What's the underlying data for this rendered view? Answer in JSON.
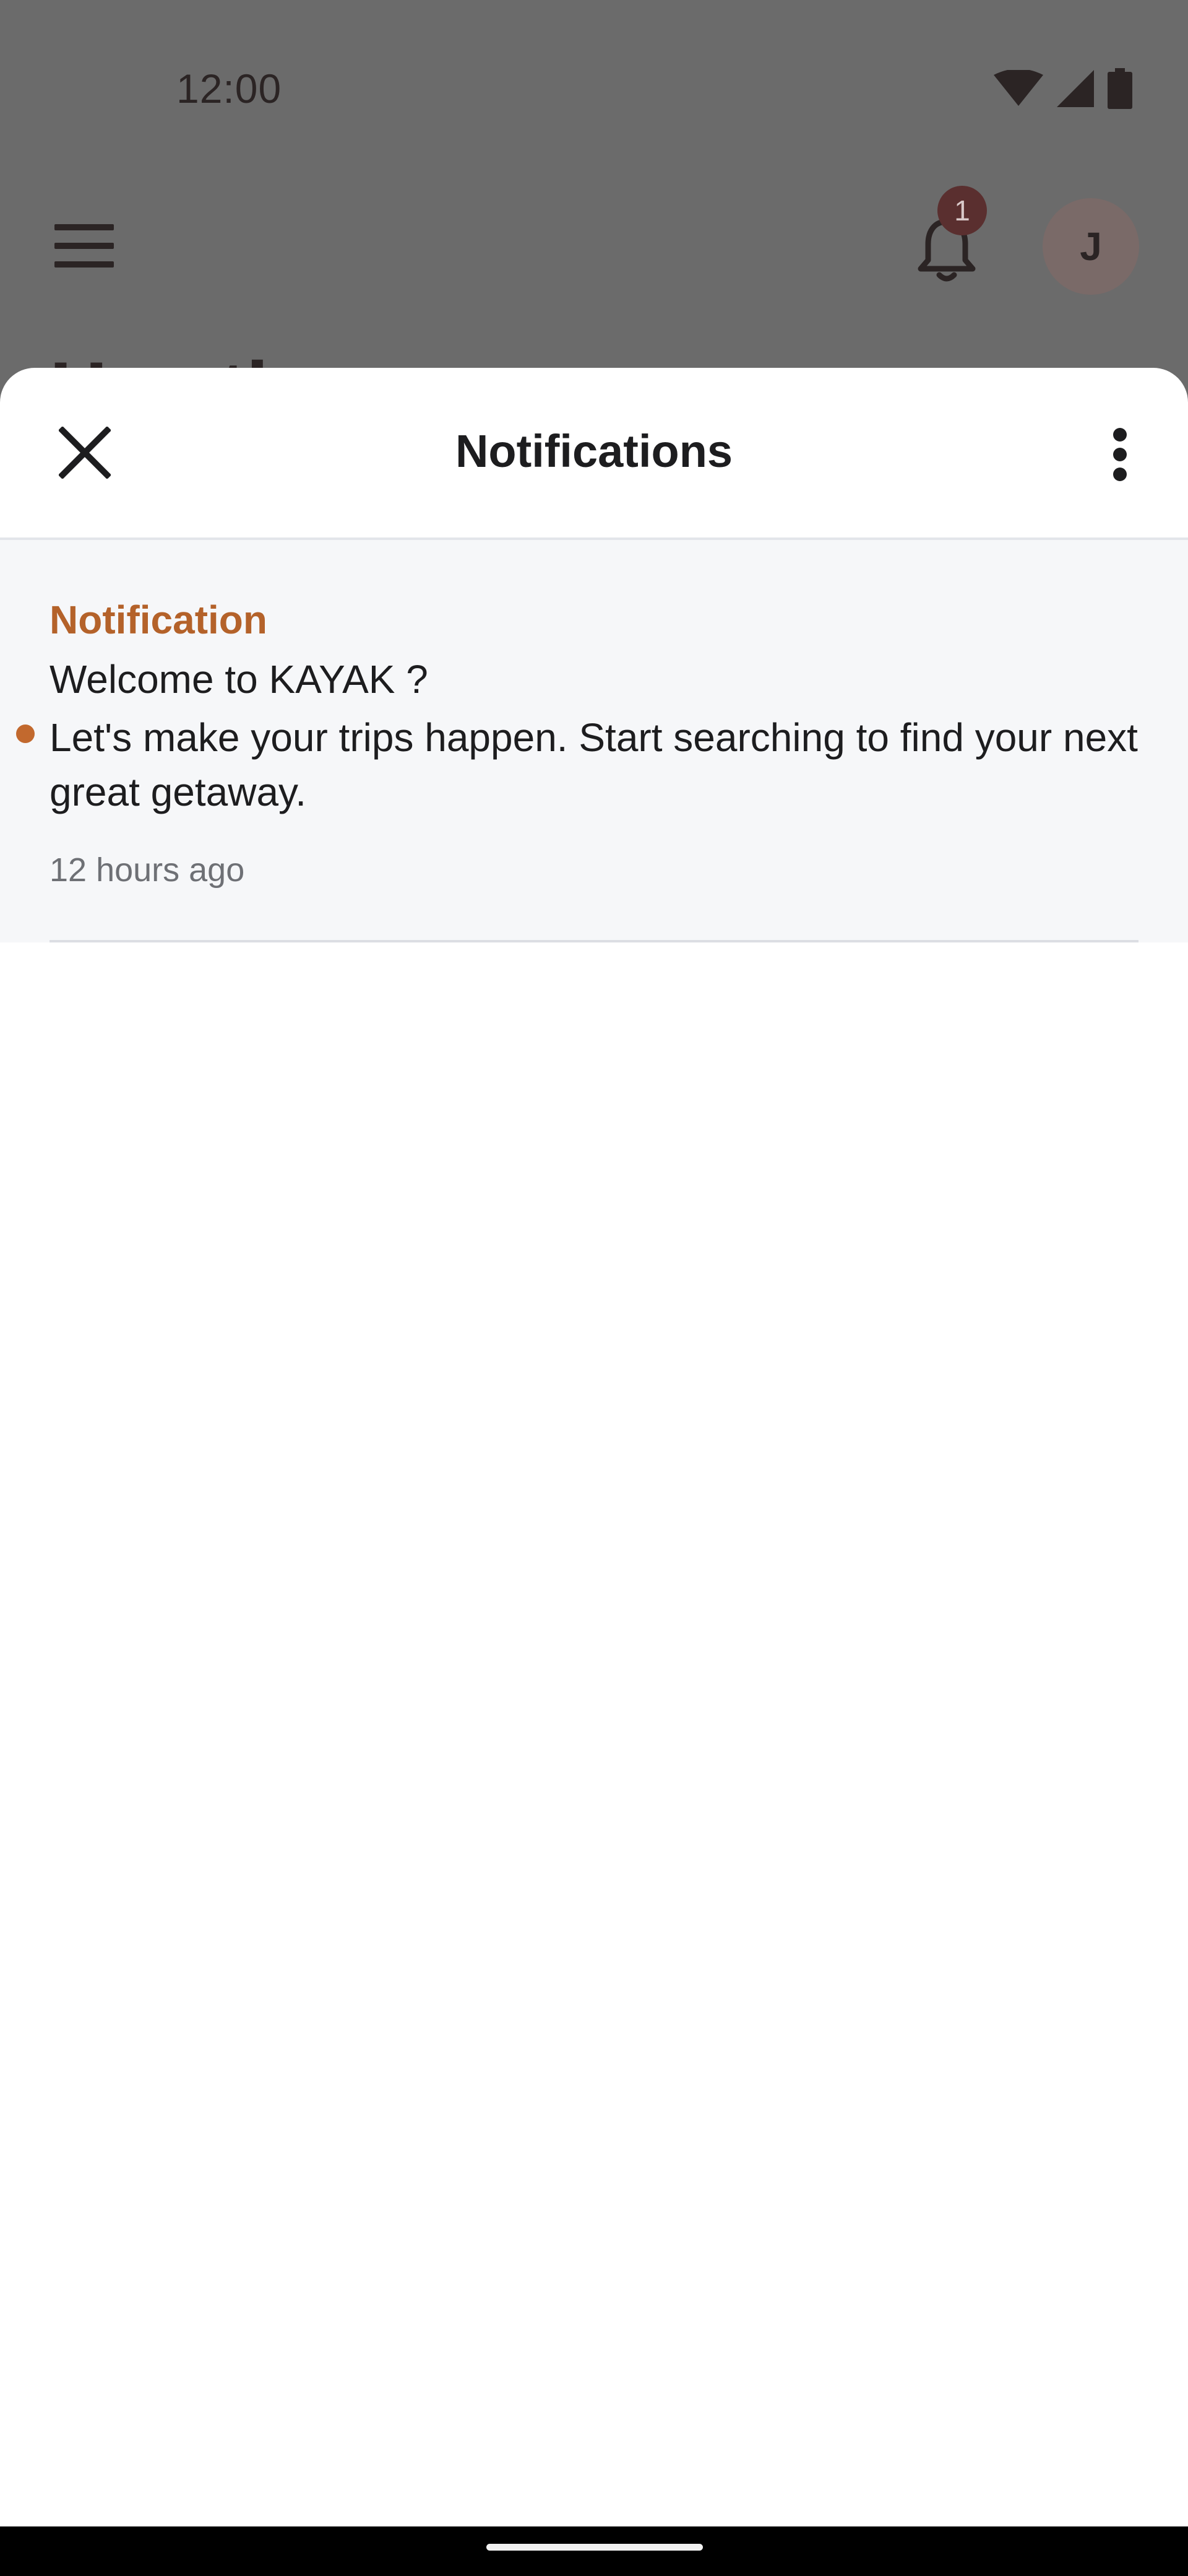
{
  "status_bar": {
    "time": "12:00"
  },
  "background_app": {
    "notification_count": "1",
    "avatar_initial": "J",
    "heading_partial": "Hey th"
  },
  "sheet": {
    "title": "Notifications",
    "close_icon": "close-icon",
    "more_icon": "more-vert-icon"
  },
  "notifications": [
    {
      "category": "Notification",
      "title": "Welcome to KAYAK ?",
      "body": "Let's make your trips happen. Start searching to find your next great getaway.",
      "time": "12 hours ago",
      "unread": true
    }
  ],
  "colors": {
    "accent": "#b4622a",
    "unread_dot": "#c2692e",
    "item_background": "#f6f7f9",
    "scrim": "#6b6b6b"
  }
}
